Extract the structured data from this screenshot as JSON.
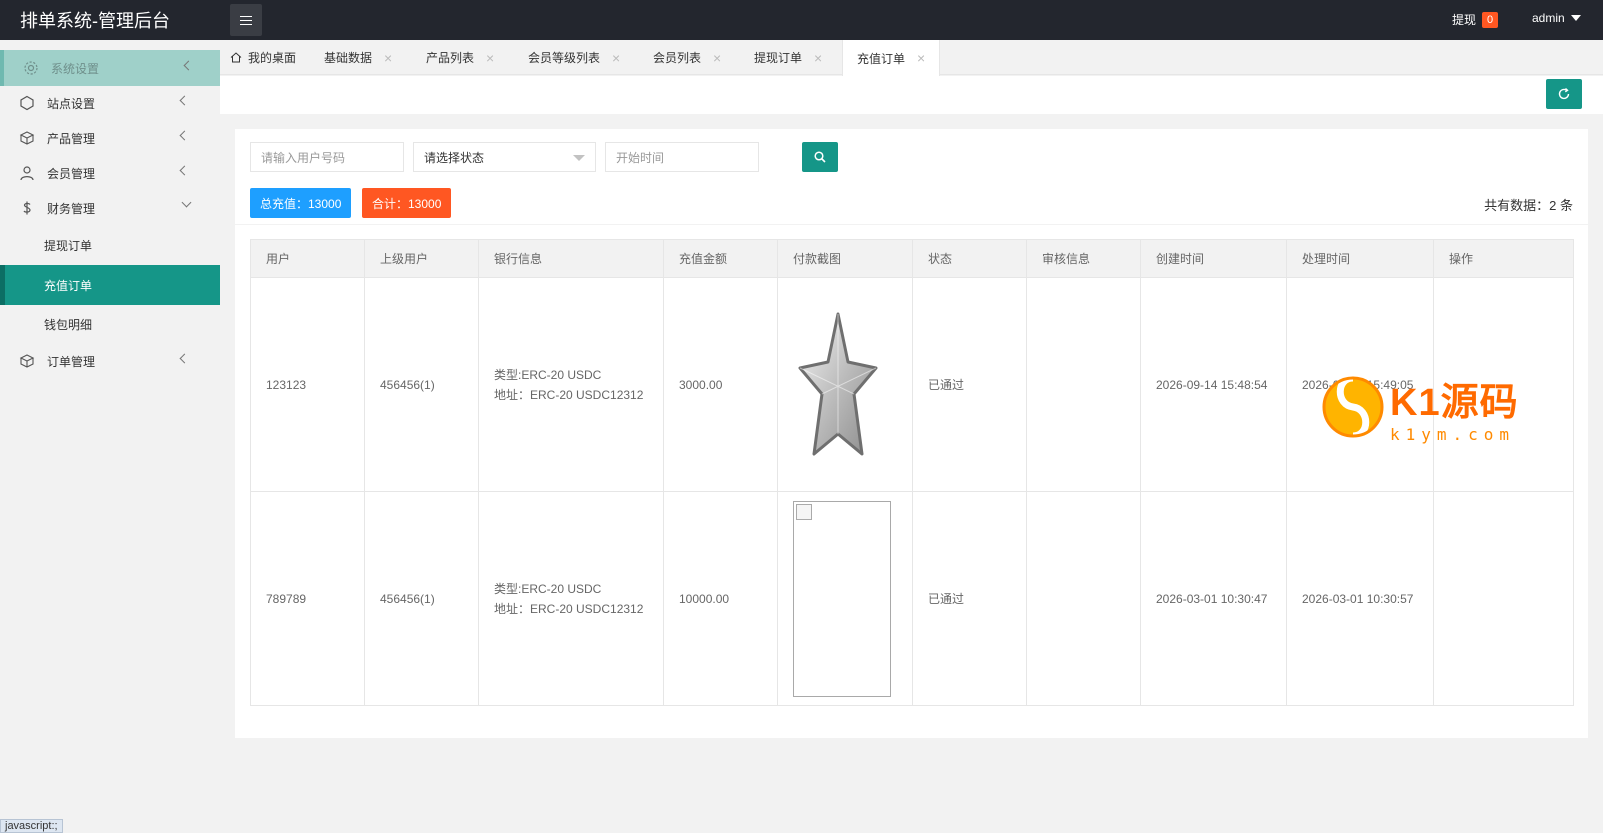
{
  "header": {
    "title": "排单系统-管理后台",
    "withdraw_label": "提现",
    "withdraw_count": "0",
    "username": "admin"
  },
  "sidebar": {
    "items": [
      {
        "label": "系统设置",
        "icon": "gear-icon"
      },
      {
        "label": "站点设置",
        "icon": "cube-icon"
      },
      {
        "label": "产品管理",
        "icon": "box-icon"
      },
      {
        "label": "会员管理",
        "icon": "user-icon"
      },
      {
        "label": "财务管理",
        "icon": "dollar-icon",
        "expanded": true,
        "children": [
          {
            "label": "提现订单"
          },
          {
            "label": "充值订单",
            "active": true
          },
          {
            "label": "钱包明细"
          }
        ]
      },
      {
        "label": "订单管理",
        "icon": "box-icon"
      }
    ]
  },
  "tabs": [
    {
      "label": "我的桌面",
      "home": true
    },
    {
      "label": "基础数据"
    },
    {
      "label": "产品列表"
    },
    {
      "label": "会员等级列表"
    },
    {
      "label": "会员列表"
    },
    {
      "label": "提现订单"
    },
    {
      "label": "充值订单",
      "active": true
    }
  ],
  "tab_close_glyph": "×",
  "filters": {
    "user_placeholder": "请输入用户号码",
    "status_value": "请选择状态",
    "start_time_placeholder": "开始时间"
  },
  "stats": {
    "total_recharge": "总充值：13000",
    "sum": "合计：13000",
    "count_text": "共有数据：2 条"
  },
  "table": {
    "columns": [
      "用户",
      "上级用户",
      "银行信息",
      "充值金额",
      "付款截图",
      "状态",
      "审核信息",
      "创建时间",
      "处理时间",
      "操作"
    ],
    "rows": [
      {
        "user": "123123",
        "parent": "456456(1)",
        "bank_type": "类型:ERC-20 USDC",
        "bank_addr": "地址：ERC-20 USDC12312",
        "amount": "3000.00",
        "screenshot": "star-image",
        "status": "已通过",
        "audit": "",
        "created": "2026-09-14 15:48:54",
        "processed": "2026-09-14 15:49:05",
        "action": ""
      },
      {
        "user": "789789",
        "parent": "456456(1)",
        "bank_type": "类型:ERC-20 USDC",
        "bank_addr": "地址：ERC-20 USDC12312",
        "amount": "10000.00",
        "screenshot": "broken-image",
        "status": "已通过",
        "audit": "",
        "created": "2026-03-01 10:30:47",
        "processed": "2026-03-01 10:30:57",
        "action": ""
      }
    ]
  },
  "watermark": {
    "brand": "K1源码",
    "url": "k1ym.com"
  },
  "browser_status": "javascript:;",
  "colors": {
    "primary": "#159688",
    "blue": "#1e9fff",
    "orange": "#ff5722",
    "header_bg": "#23262e"
  }
}
